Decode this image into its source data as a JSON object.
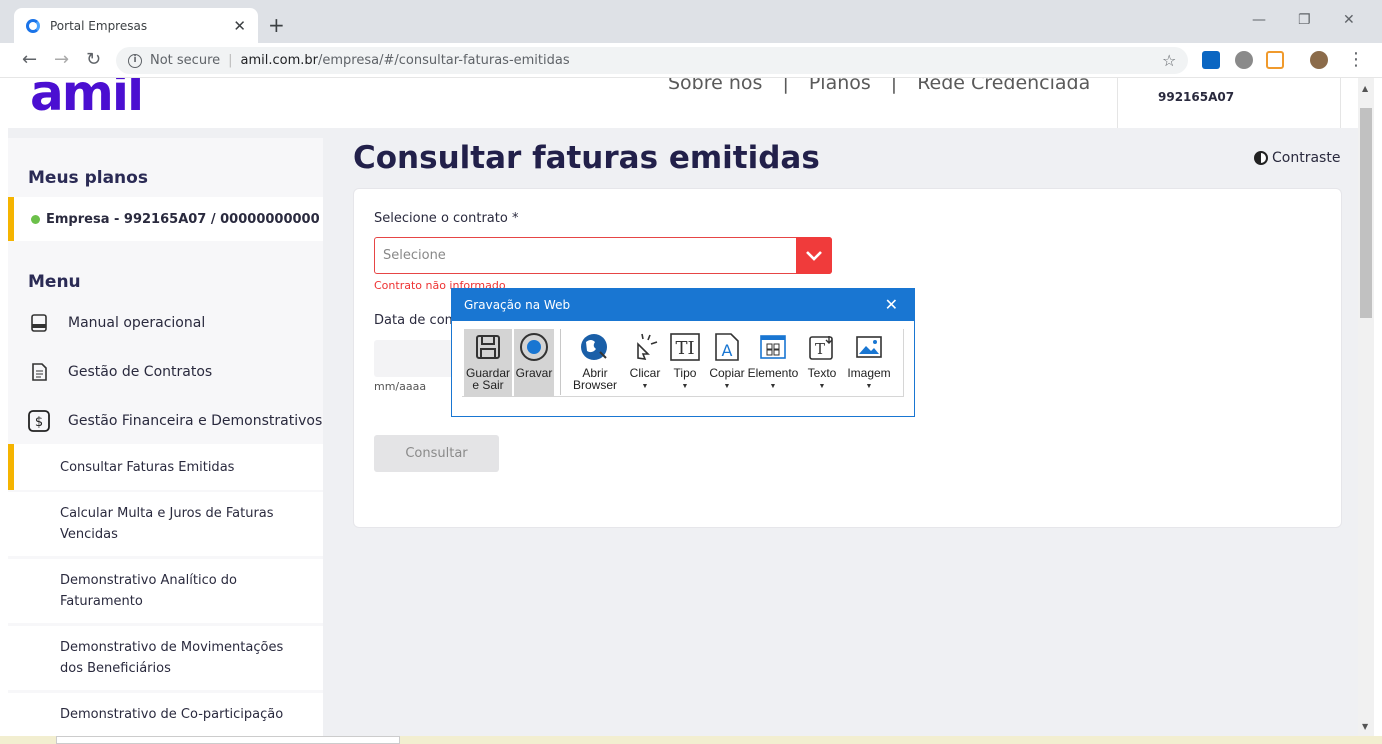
{
  "browser": {
    "tab_title": "Portal Empresas",
    "not_secure": "Not secure",
    "url_host": "amil.com.br",
    "url_path": "/empresa/#/consultar-faturas-emitidas"
  },
  "header": {
    "logo": "amil",
    "nav": [
      "Sobre nós",
      "|",
      "Planos",
      "|",
      "Rede Credenciada"
    ],
    "user_code": "992165A07"
  },
  "sidebar": {
    "plans_title": "Meus planos",
    "plan_item": "Empresa - 992165A07 / 00000000000",
    "menu_title": "Menu",
    "menu_items": [
      {
        "label": "Manual operacional"
      },
      {
        "label": "Gestão de Contratos"
      },
      {
        "label": "Gestão Financeira e Demonstrativos"
      }
    ],
    "sub_items": [
      {
        "label": "Consultar Faturas Emitidas"
      },
      {
        "label": "Calcular Multa e Juros de Faturas Vencidas"
      },
      {
        "label": "Demonstrativo Analítico do Faturamento"
      },
      {
        "label": "Demonstrativo de Movimentações dos Beneficiários"
      },
      {
        "label": "Demonstrativo de Co-participação"
      }
    ]
  },
  "main": {
    "title": "Consultar faturas emitidas",
    "contrast": "Contraste",
    "contract_label": "Selecione o contrato *",
    "select_placeholder": "Selecione",
    "error": "Contrato não informado",
    "date_label": "Data de com",
    "date_hint": "mm/aaaa",
    "consultar": "Consultar"
  },
  "dialog": {
    "title": "Gravação na Web",
    "tools": [
      {
        "line1": "Guardar",
        "line2": "e Sair"
      },
      {
        "line1": "Gravar",
        "line2": ""
      },
      {
        "line1": "Abrir",
        "line2": "Browser"
      },
      {
        "line1": "Clicar",
        "line2": ""
      },
      {
        "line1": "Tipo",
        "line2": ""
      },
      {
        "line1": "Copiar",
        "line2": ""
      },
      {
        "line1": "Elemento",
        "line2": ""
      },
      {
        "line1": "Texto",
        "line2": ""
      },
      {
        "line1": "Imagem",
        "line2": ""
      }
    ]
  }
}
